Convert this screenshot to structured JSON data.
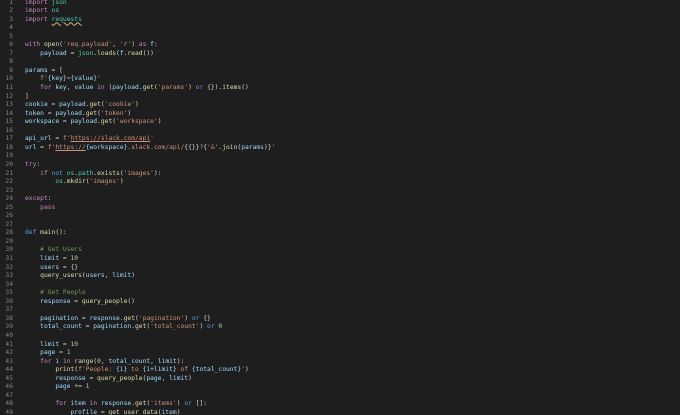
{
  "colors": {
    "background": "#1e1e1e",
    "line_number": "#858585",
    "keyword": "#c586c0",
    "def_keyword": "#569cd6",
    "function": "#dcdcaa",
    "variable": "#9cdcfe",
    "string": "#ce9178",
    "number": "#b5cea8",
    "comment": "#6a9955",
    "module": "#4ec9b0",
    "plain": "#d4d4d4"
  },
  "editor": {
    "lines": [
      {
        "n": "1",
        "tokens": [
          {
            "t": "import ",
            "c": "kw"
          },
          {
            "t": "json",
            "c": "mod"
          }
        ]
      },
      {
        "n": "2",
        "tokens": [
          {
            "t": "import ",
            "c": "kw"
          },
          {
            "t": "os",
            "c": "mod"
          }
        ]
      },
      {
        "n": "3",
        "tokens": [
          {
            "t": "import ",
            "c": "kw"
          },
          {
            "t": "requests",
            "c": "mod",
            "wavy": true
          }
        ]
      },
      {
        "n": "4",
        "tokens": []
      },
      {
        "n": "5",
        "tokens": []
      },
      {
        "n": "6",
        "tokens": [
          {
            "t": "with ",
            "c": "kw"
          },
          {
            "t": "open",
            "c": "fn"
          },
          {
            "t": "(",
            "c": "pun"
          },
          {
            "t": "'req.payload'",
            "c": "str"
          },
          {
            "t": ", ",
            "c": "pun"
          },
          {
            "t": "'r'",
            "c": "str"
          },
          {
            "t": ") ",
            "c": "pun"
          },
          {
            "t": "as ",
            "c": "kw"
          },
          {
            "t": "f",
            "c": "var"
          },
          {
            "t": ":",
            "c": "pun"
          }
        ]
      },
      {
        "n": "7",
        "tokens": [
          {
            "t": "    payload ",
            "c": "var"
          },
          {
            "t": "= ",
            "c": "pun"
          },
          {
            "t": "json",
            "c": "mod"
          },
          {
            "t": ".",
            "c": "pun"
          },
          {
            "t": "loads",
            "c": "fn"
          },
          {
            "t": "(",
            "c": "pun"
          },
          {
            "t": "f",
            "c": "var"
          },
          {
            "t": ".",
            "c": "pun"
          },
          {
            "t": "read",
            "c": "fn"
          },
          {
            "t": "())",
            "c": "pun"
          }
        ]
      },
      {
        "n": "8",
        "tokens": []
      },
      {
        "n": "9",
        "tokens": [
          {
            "t": "params ",
            "c": "var"
          },
          {
            "t": "= [",
            "c": "pun"
          }
        ]
      },
      {
        "n": "10",
        "tokens": [
          {
            "t": "    f'",
            "c": "str"
          },
          {
            "t": "{key}",
            "c": "var"
          },
          {
            "t": "=",
            "c": "str"
          },
          {
            "t": "{value}",
            "c": "var"
          },
          {
            "t": "'",
            "c": "str"
          }
        ]
      },
      {
        "n": "11",
        "tokens": [
          {
            "t": "    for ",
            "c": "kw"
          },
          {
            "t": "key",
            "c": "var"
          },
          {
            "t": ", ",
            "c": "pun"
          },
          {
            "t": "value ",
            "c": "var"
          },
          {
            "t": "in ",
            "c": "kw"
          },
          {
            "t": "(",
            "c": "pun"
          },
          {
            "t": "payload",
            "c": "var"
          },
          {
            "t": ".",
            "c": "pun"
          },
          {
            "t": "get",
            "c": "fn"
          },
          {
            "t": "(",
            "c": "pun"
          },
          {
            "t": "'params'",
            "c": "str"
          },
          {
            "t": ") ",
            "c": "pun"
          },
          {
            "t": "or ",
            "c": "def"
          },
          {
            "t": "{}).",
            "c": "pun"
          },
          {
            "t": "items",
            "c": "fn"
          },
          {
            "t": "()",
            "c": "pun"
          }
        ]
      },
      {
        "n": "12",
        "tokens": [
          {
            "t": "]",
            "c": "pun"
          }
        ]
      },
      {
        "n": "13",
        "tokens": [
          {
            "t": "cookie ",
            "c": "var"
          },
          {
            "t": "= ",
            "c": "pun"
          },
          {
            "t": "payload",
            "c": "var"
          },
          {
            "t": ".",
            "c": "pun"
          },
          {
            "t": "get",
            "c": "fn"
          },
          {
            "t": "(",
            "c": "pun"
          },
          {
            "t": "'cookie'",
            "c": "str"
          },
          {
            "t": ")",
            "c": "pun"
          }
        ]
      },
      {
        "n": "14",
        "tokens": [
          {
            "t": "token ",
            "c": "var"
          },
          {
            "t": "= ",
            "c": "pun"
          },
          {
            "t": "payload",
            "c": "var"
          },
          {
            "t": ".",
            "c": "pun"
          },
          {
            "t": "get",
            "c": "fn"
          },
          {
            "t": "(",
            "c": "pun"
          },
          {
            "t": "'token'",
            "c": "str"
          },
          {
            "t": ")",
            "c": "pun"
          }
        ]
      },
      {
        "n": "15",
        "tokens": [
          {
            "t": "workspace ",
            "c": "var"
          },
          {
            "t": "= ",
            "c": "pun"
          },
          {
            "t": "payload",
            "c": "var"
          },
          {
            "t": ".",
            "c": "pun"
          },
          {
            "t": "get",
            "c": "fn"
          },
          {
            "t": "(",
            "c": "pun"
          },
          {
            "t": "'workspace'",
            "c": "str"
          },
          {
            "t": ")",
            "c": "pun"
          }
        ]
      },
      {
        "n": "16",
        "tokens": []
      },
      {
        "n": "17",
        "tokens": [
          {
            "t": "api_url ",
            "c": "var"
          },
          {
            "t": "= ",
            "c": "pun"
          },
          {
            "t": "f'",
            "c": "str"
          },
          {
            "t": "https://slack.com/api",
            "c": "url"
          },
          {
            "t": "'",
            "c": "str"
          }
        ]
      },
      {
        "n": "18",
        "tokens": [
          {
            "t": "url ",
            "c": "var"
          },
          {
            "t": "= ",
            "c": "pun"
          },
          {
            "t": "f'",
            "c": "str"
          },
          {
            "t": "https://",
            "c": "url"
          },
          {
            "t": "{workspace}",
            "c": "var"
          },
          {
            "t": ".slack.com/api/",
            "c": "str"
          },
          {
            "t": "{{}}",
            "c": "pun"
          },
          {
            "t": "?",
            "c": "str"
          },
          {
            "t": "{",
            "c": "pun"
          },
          {
            "t": "'&'",
            "c": "str"
          },
          {
            "t": ".",
            "c": "pun"
          },
          {
            "t": "join",
            "c": "fn"
          },
          {
            "t": "(",
            "c": "pun"
          },
          {
            "t": "params",
            "c": "var"
          },
          {
            "t": ")}",
            "c": "pun"
          },
          {
            "t": "'",
            "c": "str"
          }
        ]
      },
      {
        "n": "19",
        "tokens": []
      },
      {
        "n": "20",
        "tokens": [
          {
            "t": "try",
            "c": "kw"
          },
          {
            "t": ":",
            "c": "pun"
          }
        ]
      },
      {
        "n": "21",
        "tokens": [
          {
            "t": "    if ",
            "c": "kw"
          },
          {
            "t": "not ",
            "c": "def"
          },
          {
            "t": "os",
            "c": "mod"
          },
          {
            "t": ".",
            "c": "pun"
          },
          {
            "t": "path",
            "c": "mod"
          },
          {
            "t": ".",
            "c": "pun"
          },
          {
            "t": "exists",
            "c": "fn"
          },
          {
            "t": "(",
            "c": "pun"
          },
          {
            "t": "'images'",
            "c": "str"
          },
          {
            "t": "):",
            "c": "pun"
          }
        ]
      },
      {
        "n": "22",
        "tokens": [
          {
            "t": "        os",
            "c": "mod"
          },
          {
            "t": ".",
            "c": "pun"
          },
          {
            "t": "mkdir",
            "c": "fn"
          },
          {
            "t": "(",
            "c": "pun"
          },
          {
            "t": "'images'",
            "c": "str"
          },
          {
            "t": ")",
            "c": "pun"
          }
        ]
      },
      {
        "n": "23",
        "tokens": []
      },
      {
        "n": "24",
        "tokens": [
          {
            "t": "except",
            "c": "kw"
          },
          {
            "t": ":",
            "c": "pun"
          }
        ]
      },
      {
        "n": "25",
        "tokens": [
          {
            "t": "    pass",
            "c": "kw"
          }
        ]
      },
      {
        "n": "26",
        "tokens": []
      },
      {
        "n": "27",
        "tokens": []
      },
      {
        "n": "28",
        "tokens": [
          {
            "t": "def ",
            "c": "def"
          },
          {
            "t": "main",
            "c": "fn"
          },
          {
            "t": "():",
            "c": "pun"
          }
        ]
      },
      {
        "n": "29",
        "tokens": []
      },
      {
        "n": "30",
        "tokens": [
          {
            "t": "    # Get Users",
            "c": "cmt"
          }
        ]
      },
      {
        "n": "31",
        "tokens": [
          {
            "t": "    limit ",
            "c": "var"
          },
          {
            "t": "= ",
            "c": "pun"
          },
          {
            "t": "10",
            "c": "num"
          }
        ]
      },
      {
        "n": "32",
        "tokens": [
          {
            "t": "    users ",
            "c": "var"
          },
          {
            "t": "= {}",
            "c": "pun"
          }
        ]
      },
      {
        "n": "33",
        "tokens": [
          {
            "t": "    query_users",
            "c": "fn"
          },
          {
            "t": "(",
            "c": "pun"
          },
          {
            "t": "users",
            "c": "var"
          },
          {
            "t": ", ",
            "c": "pun"
          },
          {
            "t": "limit",
            "c": "var"
          },
          {
            "t": ")",
            "c": "pun"
          }
        ]
      },
      {
        "n": "34",
        "tokens": []
      },
      {
        "n": "35",
        "tokens": [
          {
            "t": "    # Get People",
            "c": "cmt"
          }
        ]
      },
      {
        "n": "36",
        "tokens": [
          {
            "t": "    response ",
            "c": "var"
          },
          {
            "t": "= ",
            "c": "pun"
          },
          {
            "t": "query_people",
            "c": "fn"
          },
          {
            "t": "()",
            "c": "pun"
          }
        ]
      },
      {
        "n": "37",
        "tokens": []
      },
      {
        "n": "38",
        "tokens": [
          {
            "t": "    pagination ",
            "c": "var"
          },
          {
            "t": "= ",
            "c": "pun"
          },
          {
            "t": "response",
            "c": "var"
          },
          {
            "t": ".",
            "c": "pun"
          },
          {
            "t": "get",
            "c": "fn"
          },
          {
            "t": "(",
            "c": "pun"
          },
          {
            "t": "'pagination'",
            "c": "str"
          },
          {
            "t": ") ",
            "c": "pun"
          },
          {
            "t": "or ",
            "c": "def"
          },
          {
            "t": "{}",
            "c": "pun"
          }
        ]
      },
      {
        "n": "39",
        "tokens": [
          {
            "t": "    total_count ",
            "c": "var"
          },
          {
            "t": "= ",
            "c": "pun"
          },
          {
            "t": "pagination",
            "c": "var"
          },
          {
            "t": ".",
            "c": "pun"
          },
          {
            "t": "get",
            "c": "fn"
          },
          {
            "t": "(",
            "c": "pun"
          },
          {
            "t": "'total_count'",
            "c": "str"
          },
          {
            "t": ") ",
            "c": "pun"
          },
          {
            "t": "or ",
            "c": "def"
          },
          {
            "t": "0",
            "c": "num"
          }
        ]
      },
      {
        "n": "40",
        "tokens": []
      },
      {
        "n": "41",
        "tokens": [
          {
            "t": "    limit ",
            "c": "var"
          },
          {
            "t": "= ",
            "c": "pun"
          },
          {
            "t": "10",
            "c": "num"
          }
        ]
      },
      {
        "n": "42",
        "tokens": [
          {
            "t": "    page ",
            "c": "var"
          },
          {
            "t": "= ",
            "c": "pun"
          },
          {
            "t": "1",
            "c": "num"
          }
        ]
      },
      {
        "n": "43",
        "tokens": [
          {
            "t": "    for ",
            "c": "kw"
          },
          {
            "t": "i ",
            "c": "var"
          },
          {
            "t": "in ",
            "c": "kw"
          },
          {
            "t": "range",
            "c": "fn"
          },
          {
            "t": "(",
            "c": "pun"
          },
          {
            "t": "0",
            "c": "num"
          },
          {
            "t": ", ",
            "c": "pun"
          },
          {
            "t": "total_count",
            "c": "var"
          },
          {
            "t": ", ",
            "c": "pun"
          },
          {
            "t": "limit",
            "c": "var"
          },
          {
            "t": "):",
            "c": "pun"
          }
        ]
      },
      {
        "n": "44",
        "tokens": [
          {
            "t": "        print",
            "c": "fn"
          },
          {
            "t": "(",
            "c": "pun"
          },
          {
            "t": "f'People: ",
            "c": "str"
          },
          {
            "t": "{i}",
            "c": "var"
          },
          {
            "t": " to ",
            "c": "str"
          },
          {
            "t": "{i+limit}",
            "c": "var"
          },
          {
            "t": " of ",
            "c": "str"
          },
          {
            "t": "{total_count}",
            "c": "var"
          },
          {
            "t": "'",
            "c": "str"
          },
          {
            "t": ")",
            "c": "pun"
          }
        ]
      },
      {
        "n": "45",
        "tokens": [
          {
            "t": "        response ",
            "c": "var"
          },
          {
            "t": "= ",
            "c": "pun"
          },
          {
            "t": "query_people",
            "c": "fn"
          },
          {
            "t": "(",
            "c": "pun"
          },
          {
            "t": "page",
            "c": "var"
          },
          {
            "t": ", ",
            "c": "pun"
          },
          {
            "t": "limit",
            "c": "var"
          },
          {
            "t": ")",
            "c": "pun"
          }
        ]
      },
      {
        "n": "46",
        "tokens": [
          {
            "t": "        page ",
            "c": "var"
          },
          {
            "t": "+= ",
            "c": "pun"
          },
          {
            "t": "1",
            "c": "num"
          }
        ]
      },
      {
        "n": "47",
        "tokens": []
      },
      {
        "n": "48",
        "tokens": [
          {
            "t": "        for ",
            "c": "kw"
          },
          {
            "t": "item ",
            "c": "var"
          },
          {
            "t": "in ",
            "c": "kw"
          },
          {
            "t": "response",
            "c": "var"
          },
          {
            "t": ".",
            "c": "pun"
          },
          {
            "t": "get",
            "c": "fn"
          },
          {
            "t": "(",
            "c": "pun"
          },
          {
            "t": "'items'",
            "c": "str"
          },
          {
            "t": ") ",
            "c": "pun"
          },
          {
            "t": "or ",
            "c": "def"
          },
          {
            "t": "[]:",
            "c": "pun"
          }
        ]
      },
      {
        "n": "49",
        "tokens": [
          {
            "t": "            profile ",
            "c": "var"
          },
          {
            "t": "= ",
            "c": "pun"
          },
          {
            "t": "get_user_data",
            "c": "fn"
          },
          {
            "t": "(",
            "c": "pun"
          },
          {
            "t": "item",
            "c": "var"
          },
          {
            "t": ")",
            "c": "pun"
          }
        ]
      }
    ]
  }
}
